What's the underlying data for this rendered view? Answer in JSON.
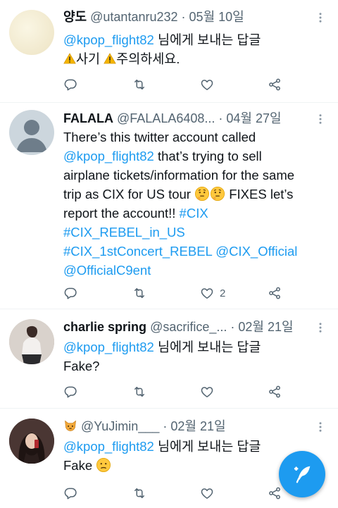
{
  "tweets": [
    {
      "name": "양도",
      "handle": "@utantanru232",
      "dot": "·",
      "date": "05월 10일",
      "reply_prefix_link": "@kpop_flight82",
      "reply_prefix_text": " 님에게 보내는 답글",
      "text_part1": "사기 ",
      "text_part2": "주의하세요.",
      "likes": ""
    },
    {
      "name": "FALALA",
      "handle": "@FALALA6408...",
      "dot": "·",
      "date": "04월 27일",
      "line1": "There’s this twitter account called",
      "line2_link": "@kpop_flight82",
      "line2_text": " that’s trying to sell",
      "line3": "airplane tickets/information for the same",
      "line4_text": "trip as CIX for US tour ",
      "line5_text": "FIXES let’s",
      "line6_text": "report the account!! ",
      "line6_link": "#CIX",
      "line7_link": "#CIX_REBEL_in_US",
      "line8_link1": "#CIX_1stConcert_REBEL",
      "line8_link2": "@CIX_Official",
      "line9_link": "@OfficialC9ent",
      "likes": "2"
    },
    {
      "name": "charlie spring",
      "handle": "@sacrifice_...",
      "dot": "·",
      "date": "02월 21일",
      "reply_prefix_link": "@kpop_flight82",
      "reply_prefix_text": " 님에게 보내는 답글",
      "text": "Fake?",
      "likes": ""
    },
    {
      "name": "",
      "handle": "@YuJimin___",
      "dot": "·",
      "date": "02월 21일",
      "reply_prefix_link": "@kpop_flight82",
      "reply_prefix_text": " 님에게 보내는 답글",
      "text": "Fake ",
      "likes": ""
    }
  ],
  "colors": {
    "link": "#1d9bf0",
    "muted": "#536471",
    "text": "#0f1419",
    "fab": "#1d9bf0"
  },
  "icons": [
    "reply-icon",
    "retweet-icon",
    "like-icon",
    "share-icon",
    "more-icon",
    "compose-icon",
    "warning-emoji",
    "thinking-emoji",
    "cat-emoji"
  ]
}
